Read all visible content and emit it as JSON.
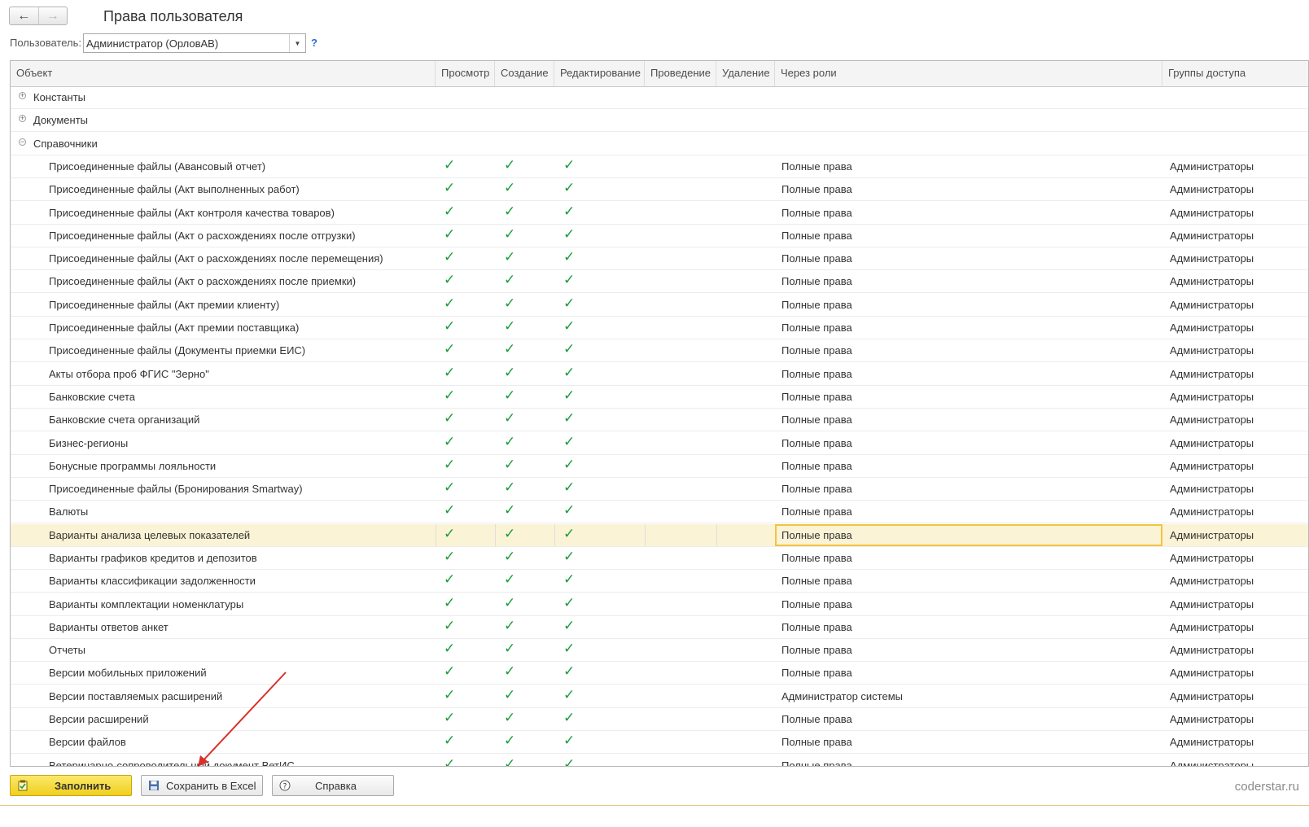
{
  "window": {
    "title": "Права пользователя"
  },
  "user_selector": {
    "label": "Пользователь:",
    "value": "Администратор (ОрловАВ)",
    "help": "?"
  },
  "table": {
    "columns": [
      "Объект",
      "Просмотр",
      "Создание",
      "Редактирование",
      "Проведение",
      "Удаление",
      "Через роли",
      "Группы доступа"
    ],
    "groups": [
      {
        "label": "Константы",
        "state": "collapsed"
      },
      {
        "label": "Документы",
        "state": "collapsed"
      },
      {
        "label": "Справочники",
        "state": "expanded"
      }
    ],
    "check_glyph": "✓",
    "rows": [
      {
        "object": "Присоединенные файлы (Авансовый отчет)",
        "view": true,
        "create": true,
        "edit": true,
        "roles": "Полные права",
        "groups": "Администраторы"
      },
      {
        "object": "Присоединенные файлы (Акт выполненных работ)",
        "view": true,
        "create": true,
        "edit": true,
        "roles": "Полные права",
        "groups": "Администраторы"
      },
      {
        "object": "Присоединенные файлы (Акт контроля качества товаров)",
        "view": true,
        "create": true,
        "edit": true,
        "roles": "Полные права",
        "groups": "Администраторы"
      },
      {
        "object": "Присоединенные файлы (Акт о расхождениях после отгрузки)",
        "view": true,
        "create": true,
        "edit": true,
        "roles": "Полные права",
        "groups": "Администраторы"
      },
      {
        "object": "Присоединенные файлы (Акт о расхождениях после перемещения)",
        "view": true,
        "create": true,
        "edit": true,
        "roles": "Полные права",
        "groups": "Администраторы"
      },
      {
        "object": "Присоединенные файлы (Акт о расхождениях после приемки)",
        "view": true,
        "create": true,
        "edit": true,
        "roles": "Полные права",
        "groups": "Администраторы"
      },
      {
        "object": "Присоединенные файлы (Акт премии клиенту)",
        "view": true,
        "create": true,
        "edit": true,
        "roles": "Полные права",
        "groups": "Администраторы"
      },
      {
        "object": "Присоединенные файлы (Акт премии поставщика)",
        "view": true,
        "create": true,
        "edit": true,
        "roles": "Полные права",
        "groups": "Администраторы"
      },
      {
        "object": "Присоединенные файлы (Документы приемки ЕИС)",
        "view": true,
        "create": true,
        "edit": true,
        "roles": "Полные права",
        "groups": "Администраторы"
      },
      {
        "object": "Акты отбора проб ФГИС \"Зерно\"",
        "view": true,
        "create": true,
        "edit": true,
        "roles": "Полные права",
        "groups": "Администраторы"
      },
      {
        "object": "Банковские счета",
        "view": true,
        "create": true,
        "edit": true,
        "roles": "Полные права",
        "groups": "Администраторы"
      },
      {
        "object": "Банковские счета организаций",
        "view": true,
        "create": true,
        "edit": true,
        "roles": "Полные права",
        "groups": "Администраторы"
      },
      {
        "object": "Бизнес-регионы",
        "view": true,
        "create": true,
        "edit": true,
        "roles": "Полные права",
        "groups": "Администраторы"
      },
      {
        "object": "Бонусные программы лояльности",
        "view": true,
        "create": true,
        "edit": true,
        "roles": "Полные права",
        "groups": "Администраторы"
      },
      {
        "object": "Присоединенные файлы (Бронирования Smartway)",
        "view": true,
        "create": true,
        "edit": true,
        "roles": "Полные права",
        "groups": "Администраторы"
      },
      {
        "object": "Валюты",
        "view": true,
        "create": true,
        "edit": true,
        "roles": "Полные права",
        "groups": "Администраторы"
      },
      {
        "object": "Варианты анализа целевых показателей",
        "view": true,
        "create": true,
        "edit": true,
        "roles": "Полные права",
        "groups": "Администраторы",
        "selected": true
      },
      {
        "object": "Варианты графиков кредитов и депозитов",
        "view": true,
        "create": true,
        "edit": true,
        "roles": "Полные права",
        "groups": "Администраторы"
      },
      {
        "object": "Варианты классификации задолженности",
        "view": true,
        "create": true,
        "edit": true,
        "roles": "Полные права",
        "groups": "Администраторы"
      },
      {
        "object": "Варианты комплектации номенклатуры",
        "view": true,
        "create": true,
        "edit": true,
        "roles": "Полные права",
        "groups": "Администраторы"
      },
      {
        "object": "Варианты ответов анкет",
        "view": true,
        "create": true,
        "edit": true,
        "roles": "Полные права",
        "groups": "Администраторы"
      },
      {
        "object": "Отчеты",
        "view": true,
        "create": true,
        "edit": true,
        "roles": "Полные права",
        "groups": "Администраторы"
      },
      {
        "object": "Версии мобильных приложений",
        "view": true,
        "create": true,
        "edit": true,
        "roles": "Полные права",
        "groups": "Администраторы"
      },
      {
        "object": "Версии поставляемых расширений",
        "view": true,
        "create": true,
        "edit": true,
        "roles": "Администратор системы",
        "groups": "Администраторы"
      },
      {
        "object": "Версии расширений",
        "view": true,
        "create": true,
        "edit": true,
        "roles": "Полные права",
        "groups": "Администраторы"
      },
      {
        "object": "Версии файлов",
        "view": true,
        "create": true,
        "edit": true,
        "roles": "Полные права",
        "groups": "Администраторы"
      },
      {
        "object": "Ветеринарно-сопроводительный документ ВетИС",
        "view": true,
        "create": true,
        "edit": true,
        "roles": "Полные права",
        "groups": "Администраторы"
      }
    ]
  },
  "buttons": {
    "fill": "Заполнить",
    "save_excel": "Сохранить в Excel",
    "help": "Справка"
  },
  "footer": {
    "watermark": "coderstar.ru"
  },
  "colors": {
    "check": "#1a9c3a",
    "selected_row": "#fbf3d5",
    "selected_cell_border": "#f3c340",
    "fill_button": "#f3d22b",
    "annotation_arrow": "#d9302b"
  }
}
